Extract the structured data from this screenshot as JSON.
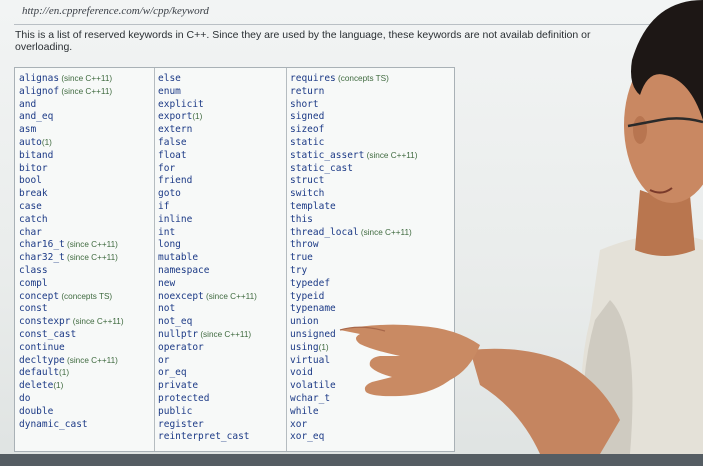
{
  "page": {
    "url": "http://en.cppreference.com/w/cpp/keyword",
    "intro": "This is a list of reserved keywords in C++. Since they are used by the language, these keywords are not availab definition or overloading."
  },
  "keywords": {
    "col1": [
      {
        "word": "alignas",
        "note": "(since C++11)"
      },
      {
        "word": "alignof",
        "note": "(since C++11)"
      },
      {
        "word": "and",
        "note": ""
      },
      {
        "word": "and_eq",
        "note": ""
      },
      {
        "word": "asm",
        "note": ""
      },
      {
        "word": "auto",
        "note": "(1)"
      },
      {
        "word": "bitand",
        "note": ""
      },
      {
        "word": "bitor",
        "note": ""
      },
      {
        "word": "bool",
        "note": ""
      },
      {
        "word": "break",
        "note": ""
      },
      {
        "word": "case",
        "note": ""
      },
      {
        "word": "catch",
        "note": ""
      },
      {
        "word": "char",
        "note": ""
      },
      {
        "word": "char16_t",
        "note": "(since C++11)"
      },
      {
        "word": "char32_t",
        "note": "(since C++11)"
      },
      {
        "word": "class",
        "note": ""
      },
      {
        "word": "compl",
        "note": ""
      },
      {
        "word": "concept",
        "note": "(concepts TS)"
      },
      {
        "word": "const",
        "note": ""
      },
      {
        "word": "constexpr",
        "note": "(since C++11)"
      },
      {
        "word": "const_cast",
        "note": ""
      },
      {
        "word": "continue",
        "note": ""
      },
      {
        "word": "decltype",
        "note": "(since C++11)"
      },
      {
        "word": "default",
        "note": "(1)"
      },
      {
        "word": "delete",
        "note": "(1)"
      },
      {
        "word": "do",
        "note": ""
      },
      {
        "word": "double",
        "note": ""
      },
      {
        "word": "dynamic_cast",
        "note": ""
      }
    ],
    "col2": [
      {
        "word": "else",
        "note": ""
      },
      {
        "word": "enum",
        "note": ""
      },
      {
        "word": "explicit",
        "note": ""
      },
      {
        "word": "export",
        "note": "(1)"
      },
      {
        "word": "extern",
        "note": ""
      },
      {
        "word": "false",
        "note": ""
      },
      {
        "word": "float",
        "note": ""
      },
      {
        "word": "for",
        "note": ""
      },
      {
        "word": "friend",
        "note": ""
      },
      {
        "word": "goto",
        "note": ""
      },
      {
        "word": "if",
        "note": ""
      },
      {
        "word": "inline",
        "note": ""
      },
      {
        "word": "int",
        "note": ""
      },
      {
        "word": "long",
        "note": ""
      },
      {
        "word": "mutable",
        "note": ""
      },
      {
        "word": "namespace",
        "note": ""
      },
      {
        "word": "new",
        "note": ""
      },
      {
        "word": "noexcept",
        "note": "(since C++11)"
      },
      {
        "word": "not",
        "note": ""
      },
      {
        "word": "not_eq",
        "note": ""
      },
      {
        "word": "nullptr",
        "note": "(since C++11)"
      },
      {
        "word": "operator",
        "note": ""
      },
      {
        "word": "or",
        "note": ""
      },
      {
        "word": "or_eq",
        "note": ""
      },
      {
        "word": "private",
        "note": ""
      },
      {
        "word": "protected",
        "note": ""
      },
      {
        "word": "public",
        "note": ""
      },
      {
        "word": "register",
        "note": ""
      },
      {
        "word": "reinterpret_cast",
        "note": ""
      }
    ],
    "col3": [
      {
        "word": "requires",
        "note": "(concepts TS)"
      },
      {
        "word": "return",
        "note": ""
      },
      {
        "word": "short",
        "note": ""
      },
      {
        "word": "signed",
        "note": ""
      },
      {
        "word": "sizeof",
        "note": ""
      },
      {
        "word": "static",
        "note": ""
      },
      {
        "word": "static_assert",
        "note": "(since C++11)"
      },
      {
        "word": "static_cast",
        "note": ""
      },
      {
        "word": "struct",
        "note": ""
      },
      {
        "word": "switch",
        "note": ""
      },
      {
        "word": "template",
        "note": ""
      },
      {
        "word": "this",
        "note": ""
      },
      {
        "word": "thread_local",
        "note": "(since C++11)"
      },
      {
        "word": "throw",
        "note": ""
      },
      {
        "word": "true",
        "note": ""
      },
      {
        "word": "try",
        "note": ""
      },
      {
        "word": "typedef",
        "note": ""
      },
      {
        "word": "typeid",
        "note": ""
      },
      {
        "word": "typename",
        "note": ""
      },
      {
        "word": "union",
        "note": ""
      },
      {
        "word": "unsigned",
        "note": ""
      },
      {
        "word": "using",
        "note": "(1)"
      },
      {
        "word": "virtual",
        "note": ""
      },
      {
        "word": "void",
        "note": ""
      },
      {
        "word": "volatile",
        "note": ""
      },
      {
        "word": "wchar_t",
        "note": ""
      },
      {
        "word": "while",
        "note": ""
      },
      {
        "word": "xor",
        "note": ""
      },
      {
        "word": "xor_eq",
        "note": ""
      }
    ]
  },
  "colors": {
    "keyword": "#1c3a86",
    "note": "#3f6a3f",
    "screen_bg": "#eef0f0",
    "skin": "#c8845f",
    "hair": "#1b1614",
    "shirt": "#e6e3da"
  }
}
